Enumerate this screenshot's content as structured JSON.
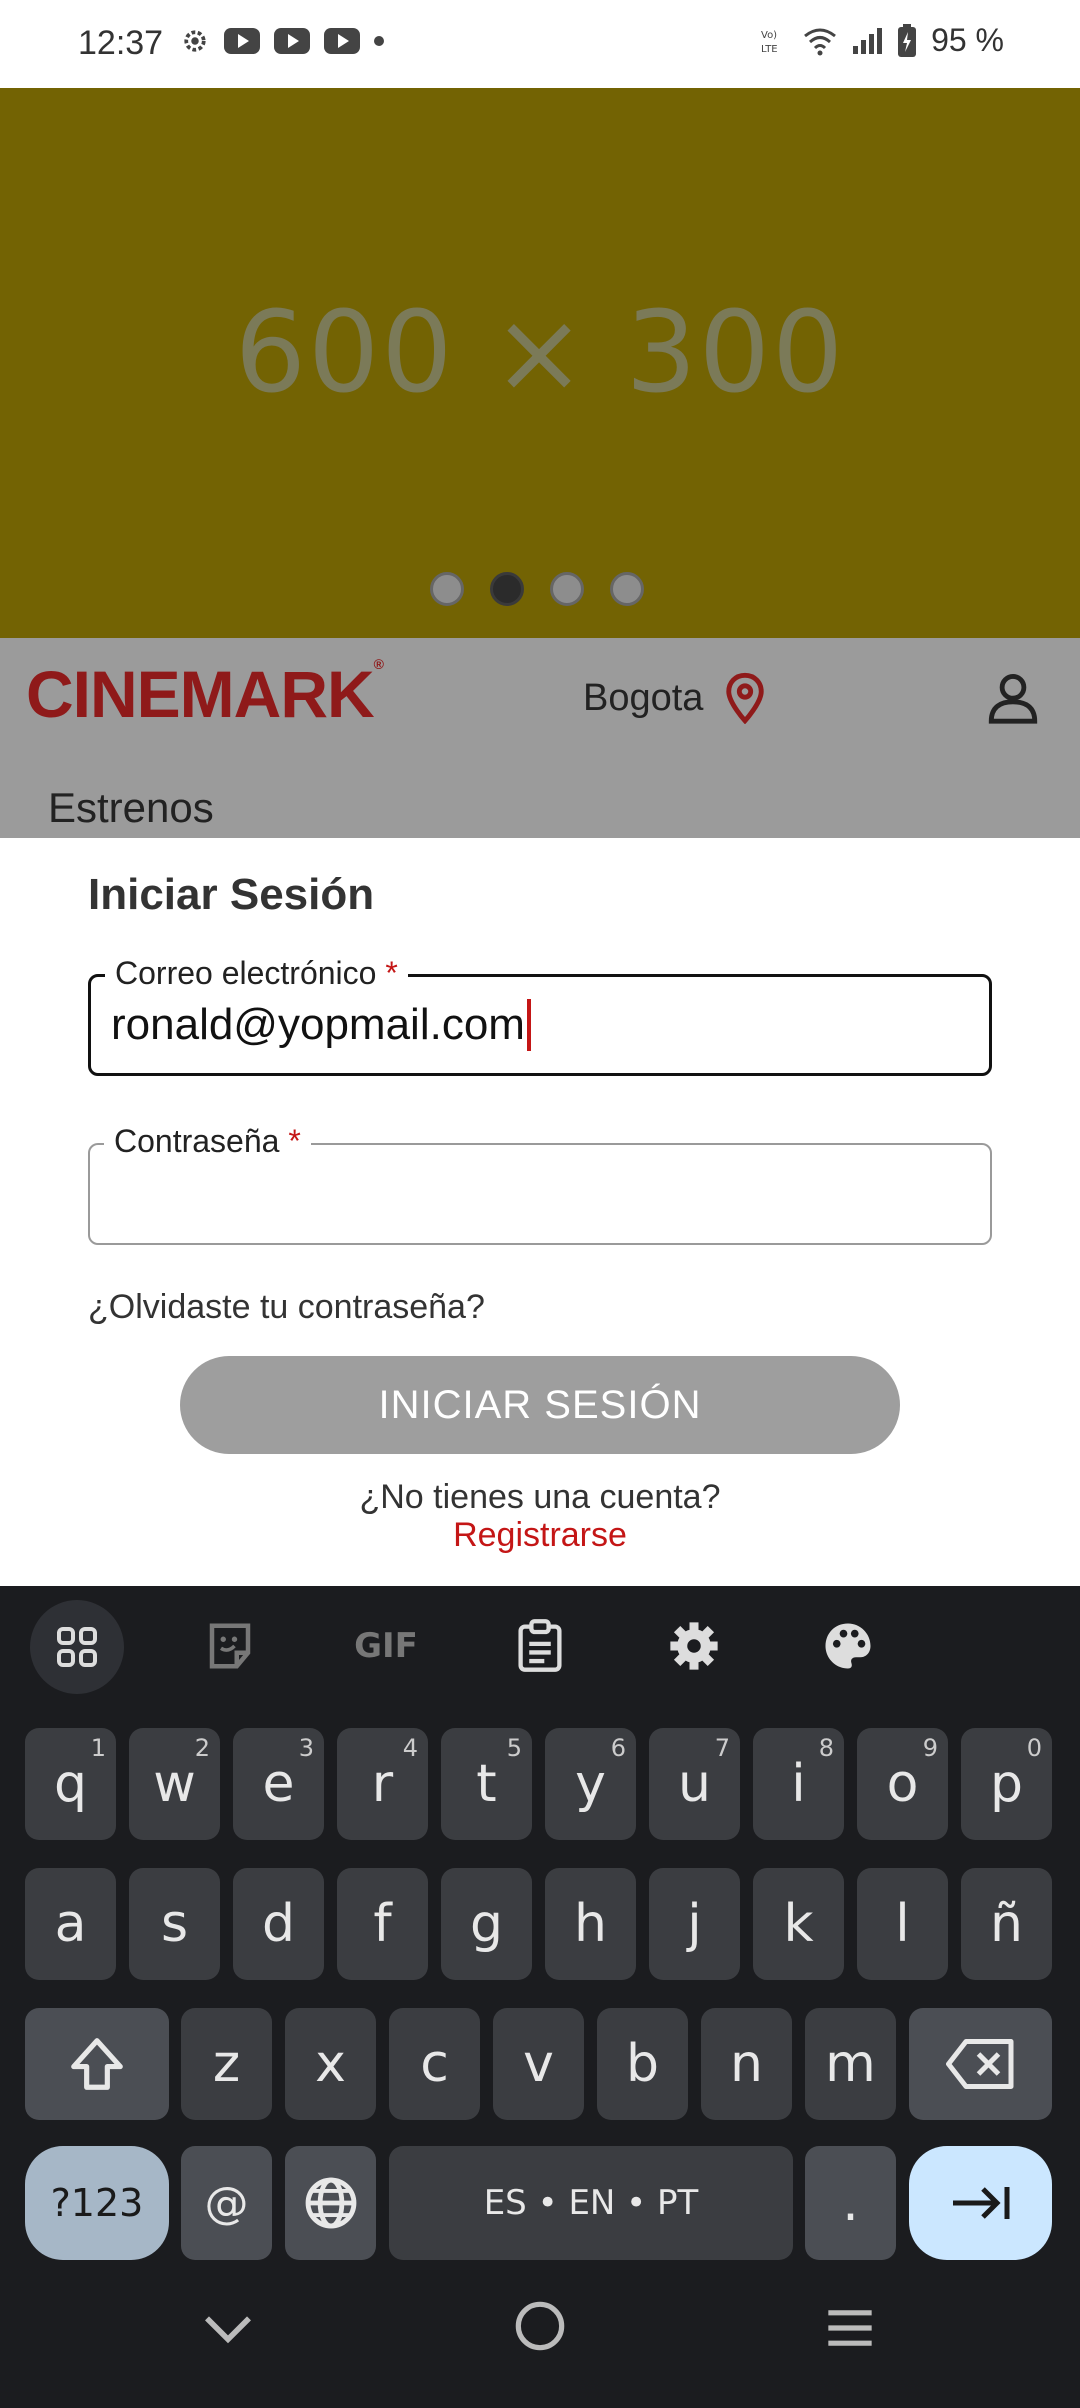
{
  "status_bar": {
    "time": "12:37",
    "battery": "95 %",
    "icons": [
      "settings-icon",
      "youtube-icon",
      "youtube-icon",
      "youtube-icon",
      "dot-icon",
      "volte-icon",
      "wifi-icon",
      "signal-icon",
      "battery-charging-icon"
    ]
  },
  "banner": {
    "placeholder_text": "600 × 300",
    "carousel_count": 4,
    "active_index": 1
  },
  "header": {
    "logo": "CINEMARK",
    "city": "Bogota",
    "section": "Estrenos"
  },
  "login": {
    "title": "Iniciar Sesión",
    "email_label": "Correo electrónico",
    "email_value": "ronald@yopmail.com",
    "password_label": "Contraseña",
    "password_value": "",
    "required_mark": "*",
    "forgot": "¿Olvidaste tu contraseña?",
    "submit": "INICIAR SESIÓN",
    "no_account": "¿No tienes una cuenta?",
    "register": "Registrarse"
  },
  "keyboard": {
    "toolbar": [
      "apps-grid-icon",
      "sticker-icon",
      "gif-icon",
      "clipboard-icon",
      "settings-icon",
      "palette-icon"
    ],
    "gif_label": "GIF",
    "row1": [
      "q",
      "w",
      "e",
      "r",
      "t",
      "y",
      "u",
      "i",
      "o",
      "p"
    ],
    "row1_hints": [
      "1",
      "2",
      "3",
      "4",
      "5",
      "6",
      "7",
      "8",
      "9",
      "0"
    ],
    "row2": [
      "a",
      "s",
      "d",
      "f",
      "g",
      "h",
      "j",
      "k",
      "l",
      "ñ"
    ],
    "row3": [
      "z",
      "x",
      "c",
      "v",
      "b",
      "n",
      "m"
    ],
    "symbols_key": "?123",
    "at_key": "@",
    "space_label": "ES • EN • PT",
    "period_key": "."
  },
  "colors": {
    "brand_red": "#8f1a1a",
    "required_red": "#c41616",
    "banner": "#736303",
    "keyboard_bg": "#1b1c1f"
  }
}
